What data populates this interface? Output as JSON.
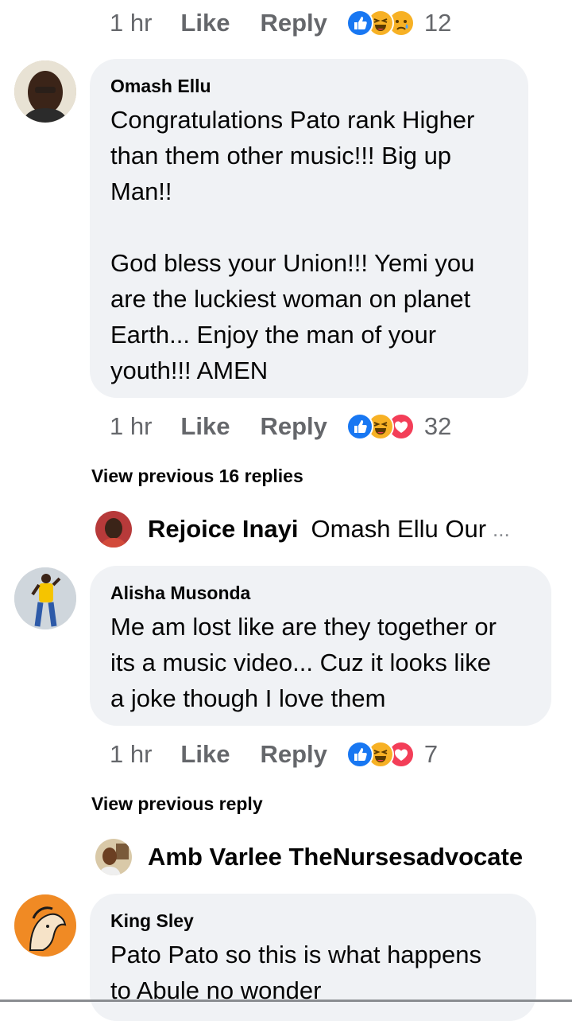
{
  "actions": [
    {
      "time": "1 hr",
      "like": "Like",
      "reply": "Reply",
      "count": "12"
    },
    {
      "time": "1 hr",
      "like": "Like",
      "reply": "Reply",
      "count": "32"
    },
    {
      "time": "1 hr",
      "like": "Like",
      "reply": "Reply",
      "count": "7"
    }
  ],
  "comments": [
    {
      "author": "Omash Ellu",
      "text": "Congratulations Pato rank Higher\nthan them other music!!! Big up\nMan!!\n\nGod bless your Union!!! Yemi you\nare the luckiest woman on planet\nEarth... Enjoy the man of your\nyouth!!! AMEN"
    },
    {
      "author": "Alisha Musonda",
      "text": "Me am lost like are they together or\nits a music video... Cuz it looks like\na joke though I love them"
    },
    {
      "author": "King Sley",
      "text": "Pato Pato so this is what happens\nto Abule no wonder"
    }
  ],
  "view_previous": [
    "View previous 16 replies",
    "View previous reply"
  ],
  "reply_previews": [
    {
      "name": "Rejoice Inayi",
      "text": "Omash Ellu  Our",
      "more": "..."
    },
    {
      "name": "Amb Varlee TheNursesadvocate",
      "text": "",
      "more": ""
    }
  ],
  "colors": {
    "bubble": "#f0f2f5",
    "muted": "#65676b",
    "like_blue": "#1877f2",
    "haha_yellow": "#f7b125",
    "love_red": "#f33e58"
  }
}
